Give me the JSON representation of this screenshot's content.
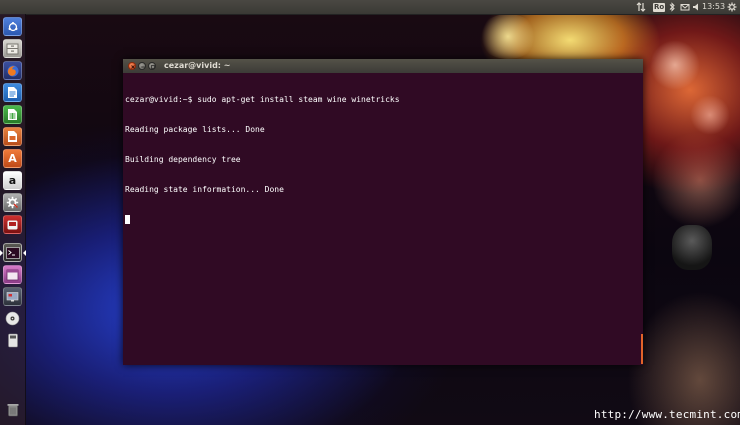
{
  "top_panel": {
    "keyboard_layout": "Ro",
    "clock": "13:53",
    "icons": [
      "network-updown-icon",
      "keyboard-layout-icon",
      "bluetooth-icon",
      "mail-icon",
      "volume-icon",
      "clock",
      "gear-icon"
    ]
  },
  "launcher": {
    "items": [
      {
        "name": "dash-home",
        "icon": "ubuntu-logo-icon",
        "color": "#3b6fd0"
      },
      {
        "name": "files",
        "icon": "file-cabinet-icon",
        "color": "#c8c6c0"
      },
      {
        "name": "firefox",
        "icon": "firefox-icon",
        "color": "#e66a1c"
      },
      {
        "name": "libreoffice-writer",
        "icon": "writer-document-icon",
        "color": "#2d7bd2"
      },
      {
        "name": "libreoffice-calc",
        "icon": "calc-spreadsheet-icon",
        "color": "#3aa33a"
      },
      {
        "name": "libreoffice-impress",
        "icon": "impress-presentation-icon",
        "color": "#d9662b"
      },
      {
        "name": "software-center",
        "icon": "shopping-bag-icon",
        "color": "#e26a2c"
      },
      {
        "name": "amazon",
        "icon": "amazon-icon",
        "color": "#f0f0f0"
      },
      {
        "name": "system-settings",
        "icon": "gear-wrench-icon",
        "color": "#9a9a9a"
      },
      {
        "name": "gaming",
        "icon": "game-icon",
        "color": "#b02020"
      },
      {
        "name": "terminal",
        "icon": "terminal-icon",
        "color": "#3c3b37"
      },
      {
        "name": "workspaces",
        "icon": "workspace-icon",
        "color": "#c060b0"
      },
      {
        "name": "remote-desktop",
        "icon": "monitor-icon",
        "color": "#444a56"
      },
      {
        "name": "dvd",
        "icon": "disc-icon",
        "color": "#e0e0e0"
      },
      {
        "name": "usb-drive",
        "icon": "drive-icon",
        "color": "#d8d8d8"
      },
      {
        "name": "trash",
        "icon": "trash-icon",
        "color": "#8a8a8a"
      }
    ],
    "amazon_glyph": "a",
    "impress_glyph": "A"
  },
  "terminal": {
    "title": "cezar@vivid: ~",
    "lines": [
      "cezar@vivid:~$ sudo apt-get install steam wine winetricks",
      "Reading package lists... Done",
      "Building dependency tree",
      "Reading state information... Done"
    ],
    "colors": {
      "background": "#300a24",
      "text": "#ffffff",
      "close": "#e0592a",
      "button": "#7c7b75"
    }
  },
  "watermark": "http://www.tecmint.com"
}
